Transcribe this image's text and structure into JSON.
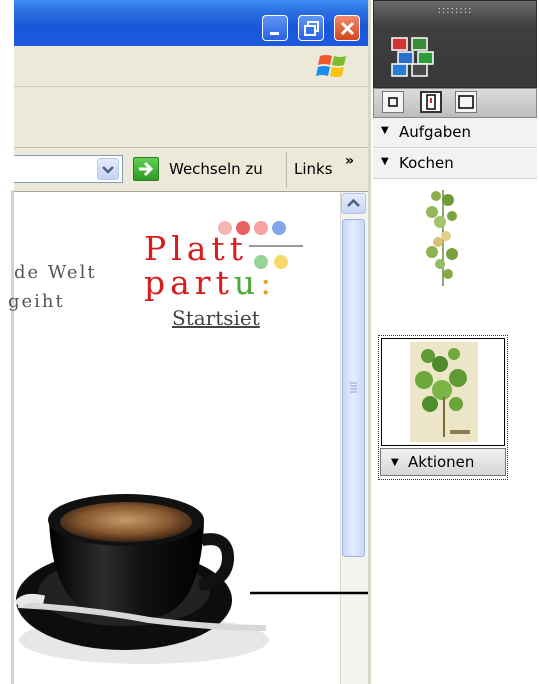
{
  "browser": {
    "window_controls": [
      "minimize",
      "restore",
      "close"
    ],
    "address_bar": {
      "value": "",
      "go_label": "Wechseln zu",
      "links_label": "Links",
      "more_label": "»"
    }
  },
  "page": {
    "tagline_line1": "de Welt",
    "tagline_line2": "geiht",
    "logo_line1": "Platt",
    "logo_line2_prefix": "part",
    "logo_line2_u": "u",
    "logo_line2_colon": ":",
    "home_link": "Startsiet"
  },
  "side_pane": {
    "grip": "::::::::",
    "sections": [
      {
        "label": "Aufgaben"
      },
      {
        "label": "Kochen"
      }
    ],
    "actions_label": "Aktionen"
  },
  "colors": {
    "titlebar": "#1a56d8",
    "logo_red": "#d81b1b",
    "logo_green": "#4fa83b",
    "logo_yellow": "#e6a21a",
    "close_button": "#d4461e"
  }
}
